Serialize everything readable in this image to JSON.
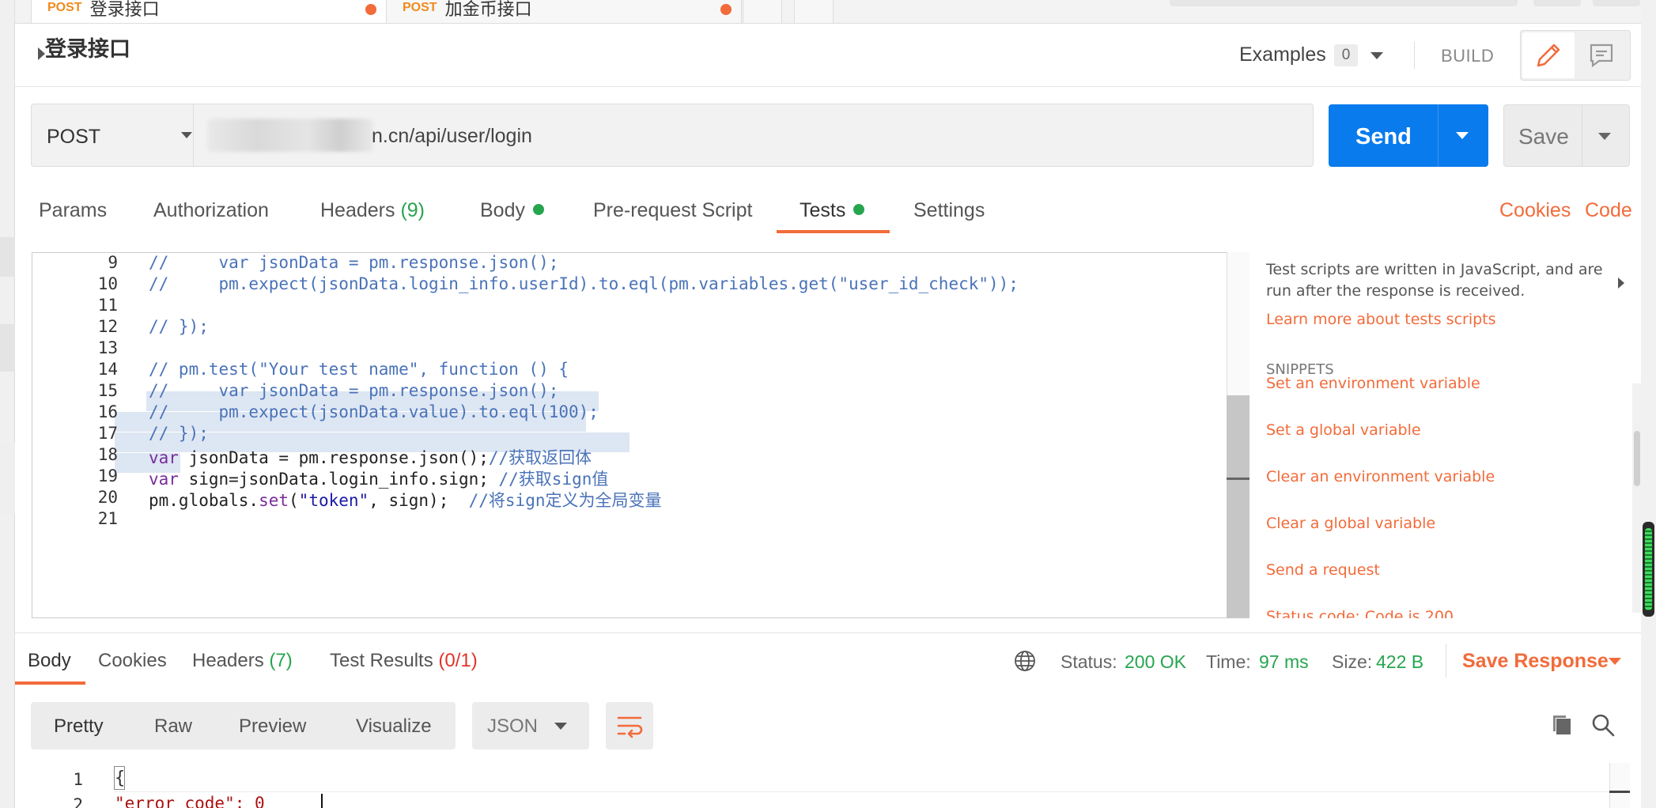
{
  "tabs": [
    {
      "method": "POST",
      "name": "登录接口"
    },
    {
      "method": "POST",
      "name": "加金币接口"
    }
  ],
  "request": {
    "title": "登录接口",
    "method": "POST",
    "url": "n.cn/api/user/login",
    "send_label": "Send",
    "save_label": "Save"
  },
  "header": {
    "examples_label": "Examples",
    "examples_count": "0",
    "build_label": "BUILD"
  },
  "subtabs": {
    "params": "Params",
    "authorization": "Authorization",
    "headers": "Headers",
    "headers_count": "(9)",
    "body": "Body",
    "prerequest": "Pre-request Script",
    "tests": "Tests",
    "settings": "Settings",
    "cookies": "Cookies",
    "code": "Code"
  },
  "editor": {
    "line_numbers": [
      "9",
      "10",
      "11",
      "12",
      "13",
      "14",
      "15",
      "16",
      "17",
      "18",
      "19",
      "20",
      "21"
    ],
    "lines": {
      "l9": "//     var jsonData = pm.response.json();",
      "l10": "//     pm.expect(jsonData.login_info.userId).to.eql(pm.variables.get(\"user_id_check\"));",
      "l12": "// });",
      "l14": "// pm.test(\"Your test name\", function () {",
      "l15": "//     var jsonData = pm.response.json();",
      "l16": "//     pm.expect(jsonData.value).to.eql(100);",
      "l17": "// });",
      "l18_kw": "var",
      "l18_code": " jsonData = pm.response.json();",
      "l18_cm": "//获取返回体",
      "l19_kw": "var",
      "l19_code": " sign=jsonData.login_info.sign; ",
      "l19_cm": "//获取sign值",
      "l20_code1": "pm.globals.",
      "l20_set": "set",
      "l20_code2": "(",
      "l20_str": "\"token\"",
      "l20_code3": ", sign);  ",
      "l20_cm": "//将sign定义为全局变量"
    }
  },
  "help": {
    "description": "Test scripts are written in JavaScript, and are run after the response is received.",
    "learn_more": "Learn more about tests scripts",
    "snippets_heading": "SNIPPETS",
    "snippets": [
      "Set an environment variable",
      "Set a global variable",
      "Clear an environment variable",
      "Clear a global variable",
      "Send a request",
      "Status code: Code is 200"
    ]
  },
  "response": {
    "tabs": {
      "body": "Body",
      "cookies": "Cookies",
      "headers": "Headers",
      "headers_count": "(7)",
      "test_results": "Test Results",
      "test_results_count": "(0/1)"
    },
    "status_label": "Status:",
    "status_value": "200 OK",
    "time_label": "Time:",
    "time_value": "97 ms",
    "size_label": "Size:",
    "size_value": "422 B",
    "save_response": "Save Response",
    "views": [
      "Pretty",
      "Raw",
      "Preview",
      "Visualize"
    ],
    "format": "JSON",
    "line1": "1",
    "line2": "2",
    "code1": "{",
    "code2": "\"error_code\": 0"
  },
  "colors": {
    "accent": "#f26b3a",
    "send": "#097bed",
    "success": "#26a54f",
    "error": "#e0342b"
  }
}
